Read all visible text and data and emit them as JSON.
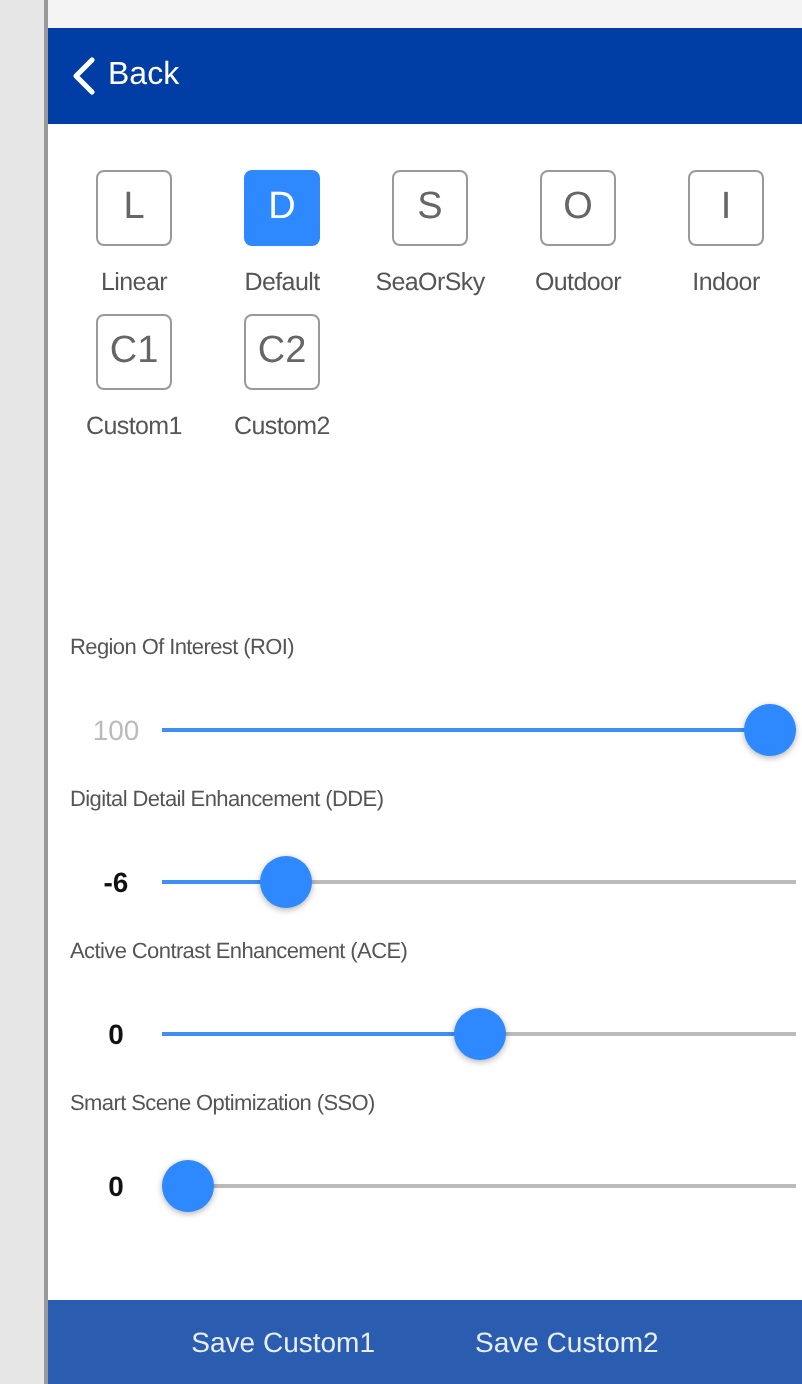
{
  "header": {
    "back_label": "Back"
  },
  "presets": [
    {
      "letter": "L",
      "label": "Linear",
      "selected": false
    },
    {
      "letter": "D",
      "label": "Default",
      "selected": true
    },
    {
      "letter": "S",
      "label": "SeaOrSky",
      "selected": false
    },
    {
      "letter": "O",
      "label": "Outdoor",
      "selected": false
    },
    {
      "letter": "I",
      "label": "Indoor",
      "selected": false
    },
    {
      "letter": "C1",
      "label": "Custom1",
      "selected": false
    },
    {
      "letter": "C2",
      "label": "Custom2",
      "selected": false
    }
  ],
  "sliders": [
    {
      "label": "Region Of Interest (ROI)",
      "reading": "100",
      "disabled": true,
      "level": 1
    },
    {
      "label": "Digital Detail Enhancement (DDE)",
      "reading": "-6",
      "disabled": false,
      "level": 0.17
    },
    {
      "label": "Active Contrast Enhancement (ACE)",
      "reading": "0",
      "disabled": false,
      "level": 0.5
    },
    {
      "label": "Smart Scene Optimization (SSO)",
      "reading": "0",
      "disabled": false,
      "level": 0
    }
  ],
  "footer_buttons": [
    "Save Custom1",
    "Save Custom2"
  ]
}
